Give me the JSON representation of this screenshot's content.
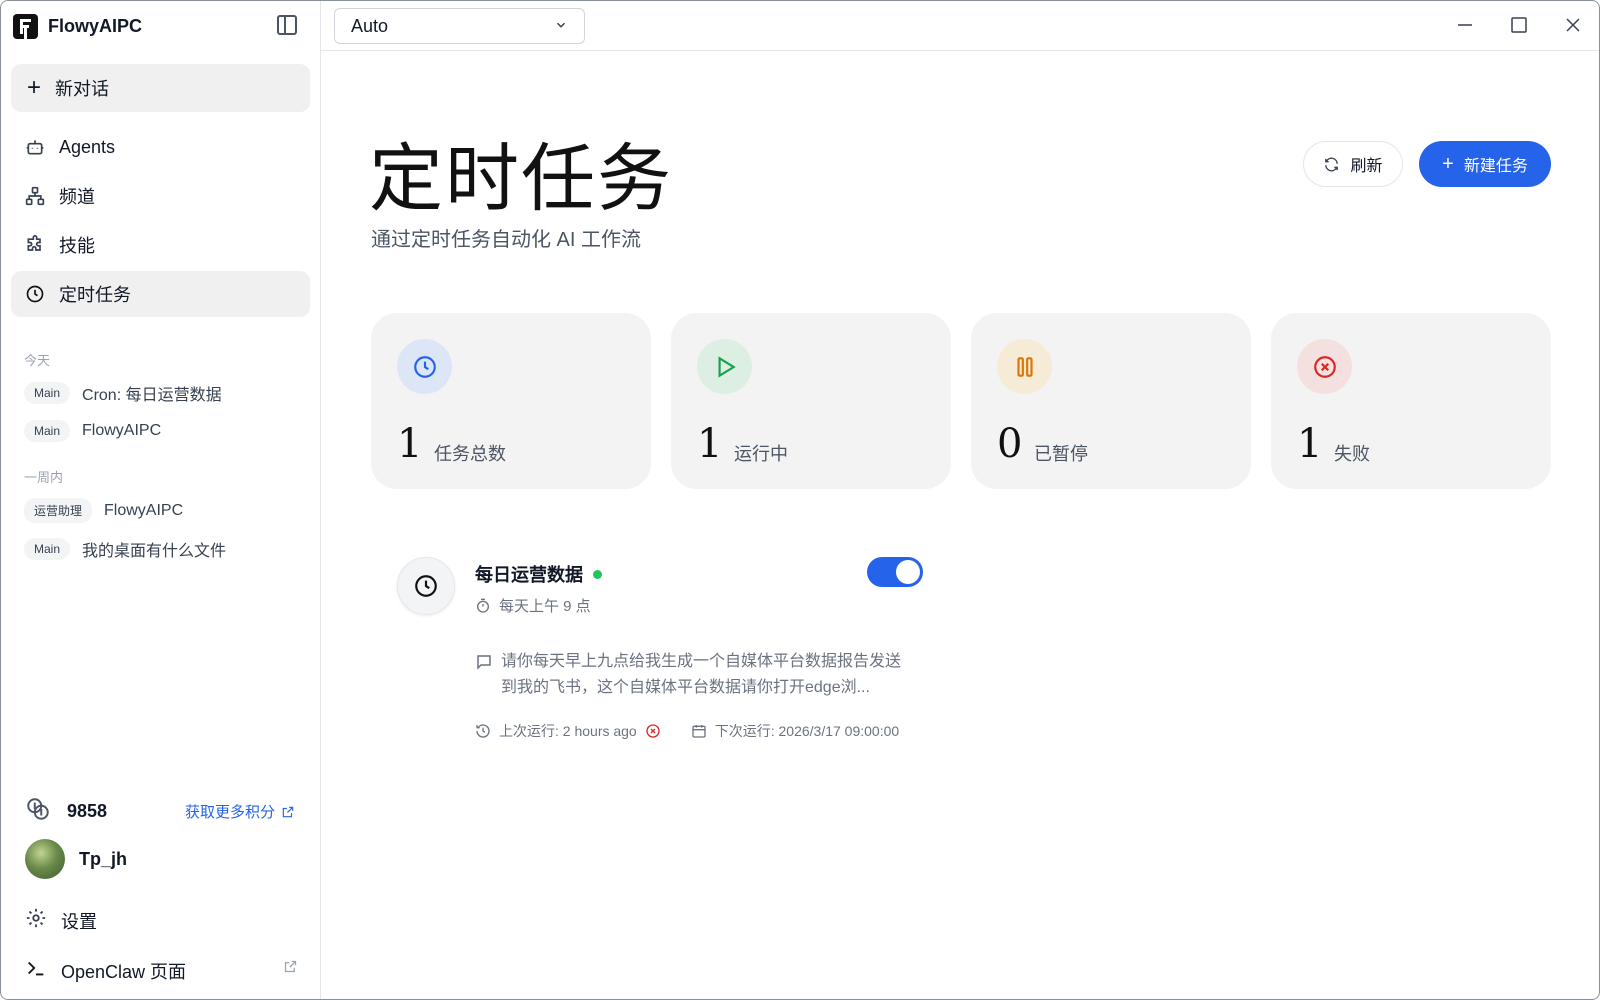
{
  "app": {
    "name": "FlowyAIPC"
  },
  "sidebar": {
    "new_chat": "新对话",
    "nav": [
      {
        "label": "Agents",
        "icon": "robot-icon"
      },
      {
        "label": "频道",
        "icon": "channel-icon"
      },
      {
        "label": "技能",
        "icon": "puzzle-icon"
      },
      {
        "label": "定时任务",
        "icon": "clock-icon",
        "active": true
      }
    ],
    "today_label": "今天",
    "week_label": "一周内",
    "history_today": [
      {
        "tag": "Main",
        "title": "Cron: 每日运营数据"
      },
      {
        "tag": "Main",
        "title": "FlowyAIPC"
      }
    ],
    "history_week": [
      {
        "tag": "运营助理",
        "title": "FlowyAIPC"
      },
      {
        "tag": "Main",
        "title": "我的桌面有什么文件"
      }
    ],
    "credits": {
      "value": "9858",
      "more_label": "获取更多积分"
    },
    "user": {
      "name": "Tp_jh"
    },
    "settings": "设置",
    "openclaw": "OpenClaw 页面"
  },
  "topbar": {
    "model": "Auto"
  },
  "main": {
    "title": "定时任务",
    "subtitle": "通过定时任务自动化 AI 工作流",
    "refresh": "刷新",
    "new_task": "新建任务",
    "stats": [
      {
        "value": "1",
        "label": "任务总数",
        "color": "#2563eb",
        "bg": "#dde6f6"
      },
      {
        "value": "1",
        "label": "运行中",
        "color": "#16a34a",
        "bg": "#dcefe2"
      },
      {
        "value": "0",
        "label": "已暂停",
        "color": "#d97706",
        "bg": "#f6ebd6"
      },
      {
        "value": "1",
        "label": "失败",
        "color": "#dc2626",
        "bg": "#f5e0e0"
      }
    ],
    "task": {
      "name": "每日运营数据",
      "schedule": "每天上午 9 点",
      "prompt": "请你每天早上九点给我生成一个自媒体平台数据报告发送到我的飞书，这个自媒体平台数据请你打开edge浏...",
      "last_run": "上次运行: 2 hours ago",
      "next_run": "下次运行: 2026/3/17 09:00:00",
      "enabled": true
    }
  }
}
